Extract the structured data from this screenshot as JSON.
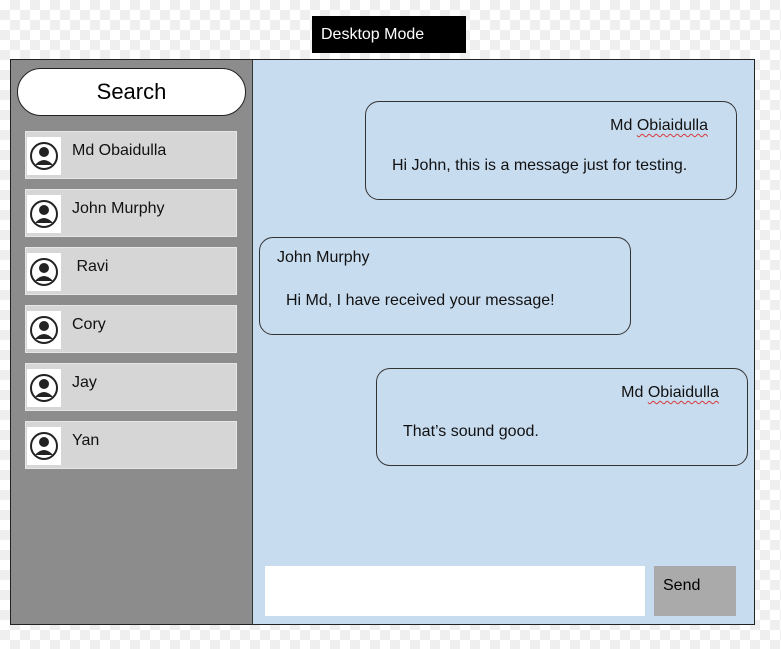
{
  "mode_label": "Desktop Mode",
  "sidebar": {
    "search_label": "Search",
    "contacts": [
      {
        "name": "Md Obaidulla"
      },
      {
        "name": "John Murphy"
      },
      {
        "name": " Ravi"
      },
      {
        "name": "Cory"
      },
      {
        "name": "Jay"
      },
      {
        "name": "Yan"
      }
    ]
  },
  "chat": {
    "messages": [
      {
        "sender_first": "Md ",
        "sender_last": "Obiaidulla",
        "text": "Hi John, this is a message just for testing.",
        "side": "right"
      },
      {
        "sender": "John Murphy",
        "text": "Hi Md, I have received your message!",
        "side": "left"
      },
      {
        "sender_first": "Md ",
        "sender_last": "Obiaidulla",
        "text": "That’s sound good.",
        "side": "right"
      }
    ],
    "input_value": "",
    "send_label": "Send"
  },
  "colors": {
    "sidebar_bg": "#8c8c8c",
    "chat_bg": "#c8dcf0",
    "contact_bg": "#d6d6d6",
    "send_bg": "#aaaaaa",
    "mode_label_bg": "#000000"
  }
}
